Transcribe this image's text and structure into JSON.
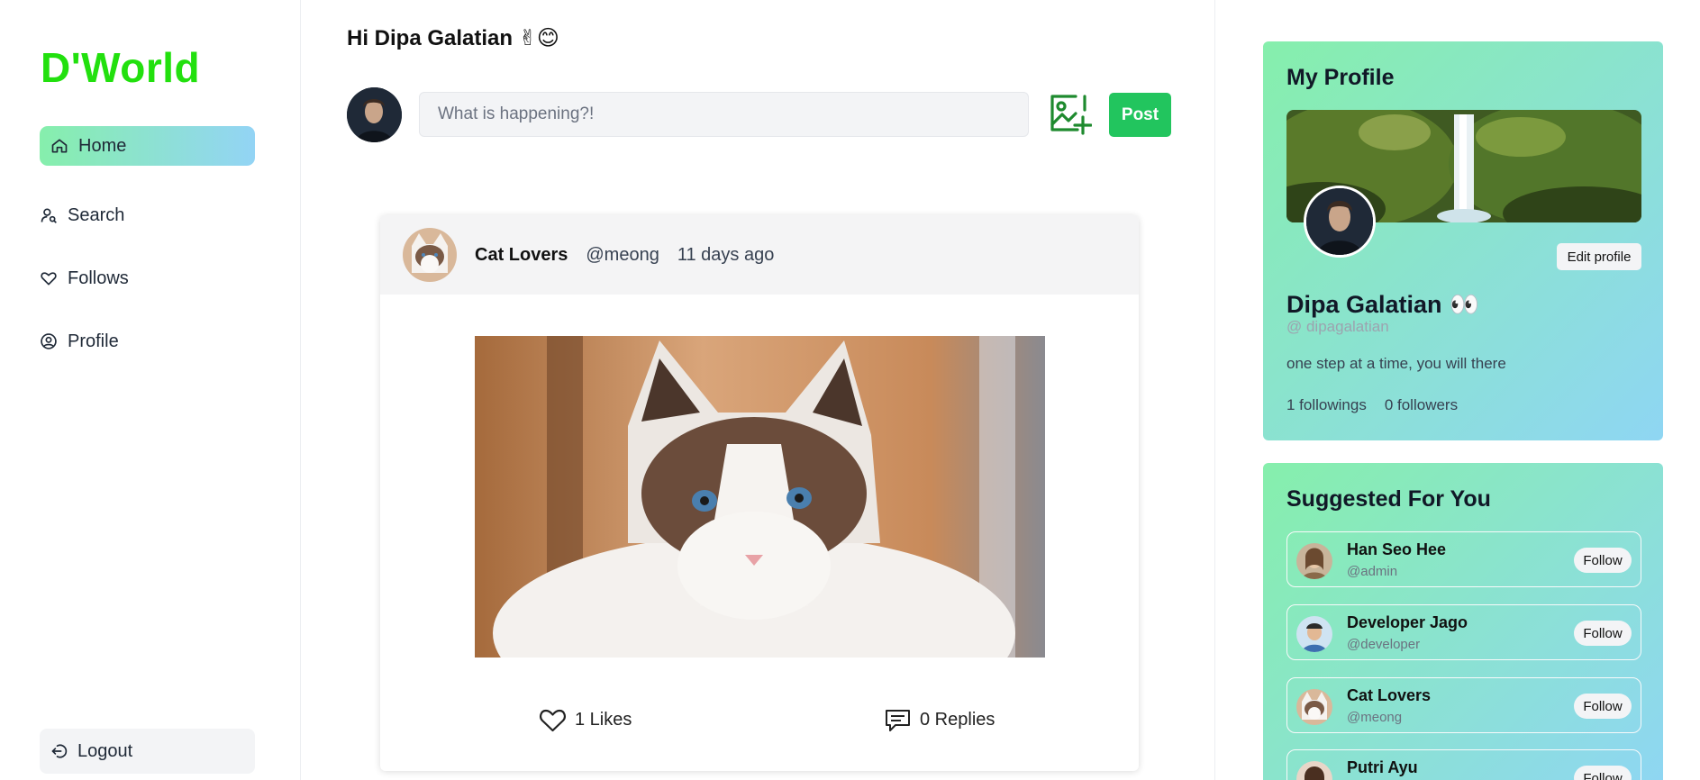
{
  "app": {
    "logo": "D'World"
  },
  "sidebar": {
    "items": [
      {
        "label": "Home",
        "icon": "home-icon",
        "active": true
      },
      {
        "label": "Search",
        "icon": "user-search-icon"
      },
      {
        "label": "Follows",
        "icon": "heart-icon"
      },
      {
        "label": "Profile",
        "icon": "user-circle-icon"
      }
    ],
    "logout_label": "Logout"
  },
  "feed": {
    "greeting": "Hi Dipa Galatian ✌😊",
    "composer": {
      "placeholder": "What is happening?!",
      "post_label": "Post"
    },
    "post": {
      "author": "Cat Lovers",
      "handle": "@meong",
      "time": "11 days ago",
      "likes": "1 Likes",
      "replies": "0 Replies"
    }
  },
  "profile": {
    "title": "My Profile",
    "edit_label": "Edit profile",
    "name": "Dipa Galatian",
    "name_emoji": "👀",
    "handle": "@ dipagalatian",
    "bio": "one step at a time, you will there",
    "followings": "1 followings",
    "followers": "0 followers"
  },
  "suggested": {
    "title": "Suggested For You",
    "follow_label": "Follow",
    "users": [
      {
        "name": "Han Seo Hee",
        "handle": "@admin"
      },
      {
        "name": "Developer Jago",
        "handle": "@developer"
      },
      {
        "name": "Cat Lovers",
        "handle": "@meong"
      },
      {
        "name": "Putri Ayu",
        "handle": ""
      }
    ]
  },
  "colors": {
    "brand": "#22e00e",
    "post_button": "#22c55e",
    "gradient_start": "#86efac",
    "gradient_end": "#8fd6f3"
  }
}
